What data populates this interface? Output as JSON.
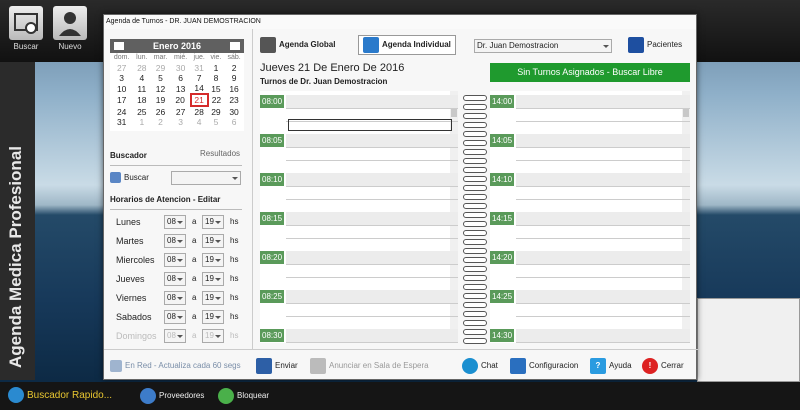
{
  "toolbar": {
    "buscar_label": "Buscar",
    "nuevo_label": "Nuevo"
  },
  "sidebar": {
    "vertical_title": "Agenda Medica Profesional"
  },
  "window": {
    "title": "Agenda de Turnos - DR. JUAN DEMOSTRACION",
    "tabs": [
      {
        "label": "Agenda Global"
      },
      {
        "label": "Agenda Individual"
      }
    ],
    "doctor_select_value": "Dr. Juan Demostracion",
    "pacientes_label": "Pacientes",
    "no_turnos_banner": "Sin Turnos Asignados - Buscar Libre",
    "date_title": "Jueves 21 De Enero De 2016",
    "turnos_de": "Turnos de Dr. Juan Demostracion"
  },
  "calendar": {
    "month_label": "Enero 2016",
    "weekdays": [
      "dom.",
      "lun.",
      "mar.",
      "mié.",
      "jue.",
      "vie.",
      "sáb."
    ],
    "weeks": [
      [
        {
          "d": "27",
          "dim": true
        },
        {
          "d": "28",
          "dim": true
        },
        {
          "d": "29",
          "dim": true
        },
        {
          "d": "30",
          "dim": true
        },
        {
          "d": "31",
          "dim": true
        },
        {
          "d": "1"
        },
        {
          "d": "2"
        }
      ],
      [
        {
          "d": "3"
        },
        {
          "d": "4"
        },
        {
          "d": "5"
        },
        {
          "d": "6"
        },
        {
          "d": "7"
        },
        {
          "d": "8"
        },
        {
          "d": "9"
        }
      ],
      [
        {
          "d": "10"
        },
        {
          "d": "11"
        },
        {
          "d": "12"
        },
        {
          "d": "13"
        },
        {
          "d": "14"
        },
        {
          "d": "15"
        },
        {
          "d": "16"
        }
      ],
      [
        {
          "d": "17"
        },
        {
          "d": "18"
        },
        {
          "d": "19"
        },
        {
          "d": "20"
        },
        {
          "d": "21",
          "sel": true
        },
        {
          "d": "22"
        },
        {
          "d": "23"
        }
      ],
      [
        {
          "d": "24"
        },
        {
          "d": "25"
        },
        {
          "d": "26"
        },
        {
          "d": "27"
        },
        {
          "d": "28"
        },
        {
          "d": "29"
        },
        {
          "d": "30"
        }
      ],
      [
        {
          "d": "31"
        },
        {
          "d": "1",
          "dim": true
        },
        {
          "d": "2",
          "dim": true
        },
        {
          "d": "3",
          "dim": true
        },
        {
          "d": "4",
          "dim": true
        },
        {
          "d": "5",
          "dim": true
        },
        {
          "d": "6",
          "dim": true
        }
      ]
    ]
  },
  "buscador": {
    "title": "Buscador",
    "resultados_label": "Resultados",
    "buscar_label": "Buscar"
  },
  "horarios": {
    "title": "Horarios de Atencion - Editar",
    "sep_a": "a",
    "unit_hs": "hs",
    "days": [
      {
        "name": "Lunes",
        "from": "08",
        "to": "19"
      },
      {
        "name": "Martes",
        "from": "08",
        "to": "19"
      },
      {
        "name": "Miercoles",
        "from": "08",
        "to": "19"
      },
      {
        "name": "Jueves",
        "from": "08",
        "to": "19"
      },
      {
        "name": "Viernes",
        "from": "08",
        "to": "19"
      },
      {
        "name": "Sabados",
        "from": "08",
        "to": "19"
      },
      {
        "name": "Domingos",
        "from": "08",
        "to": "19"
      }
    ]
  },
  "agenda_left_slots": [
    "08:00",
    "08:05",
    "08:10",
    "08:15",
    "08:20",
    "08:25",
    "08:30"
  ],
  "agenda_right_slots": [
    "14:00",
    "14:05",
    "14:10",
    "14:15",
    "14:20",
    "14:25",
    "14:30"
  ],
  "bottom_tools": {
    "status": "En Red - Actualiza cada 60 segs",
    "enviar": "Enviar",
    "anunciar": "Anunciar en Sala de Espera",
    "chat": "Chat",
    "configuracion": "Configuracion",
    "ayuda": "Ayuda",
    "cerrar": "Cerrar"
  },
  "bottom_bar": {
    "buscador_rapido": "Buscador Rapido...",
    "proveedores": "Proveedores",
    "bloquear": "Bloquear"
  },
  "colors": {
    "slot_green": "#5a9a5a",
    "banner_green": "#1f9a2e",
    "selected_day": "#d52a2a"
  }
}
